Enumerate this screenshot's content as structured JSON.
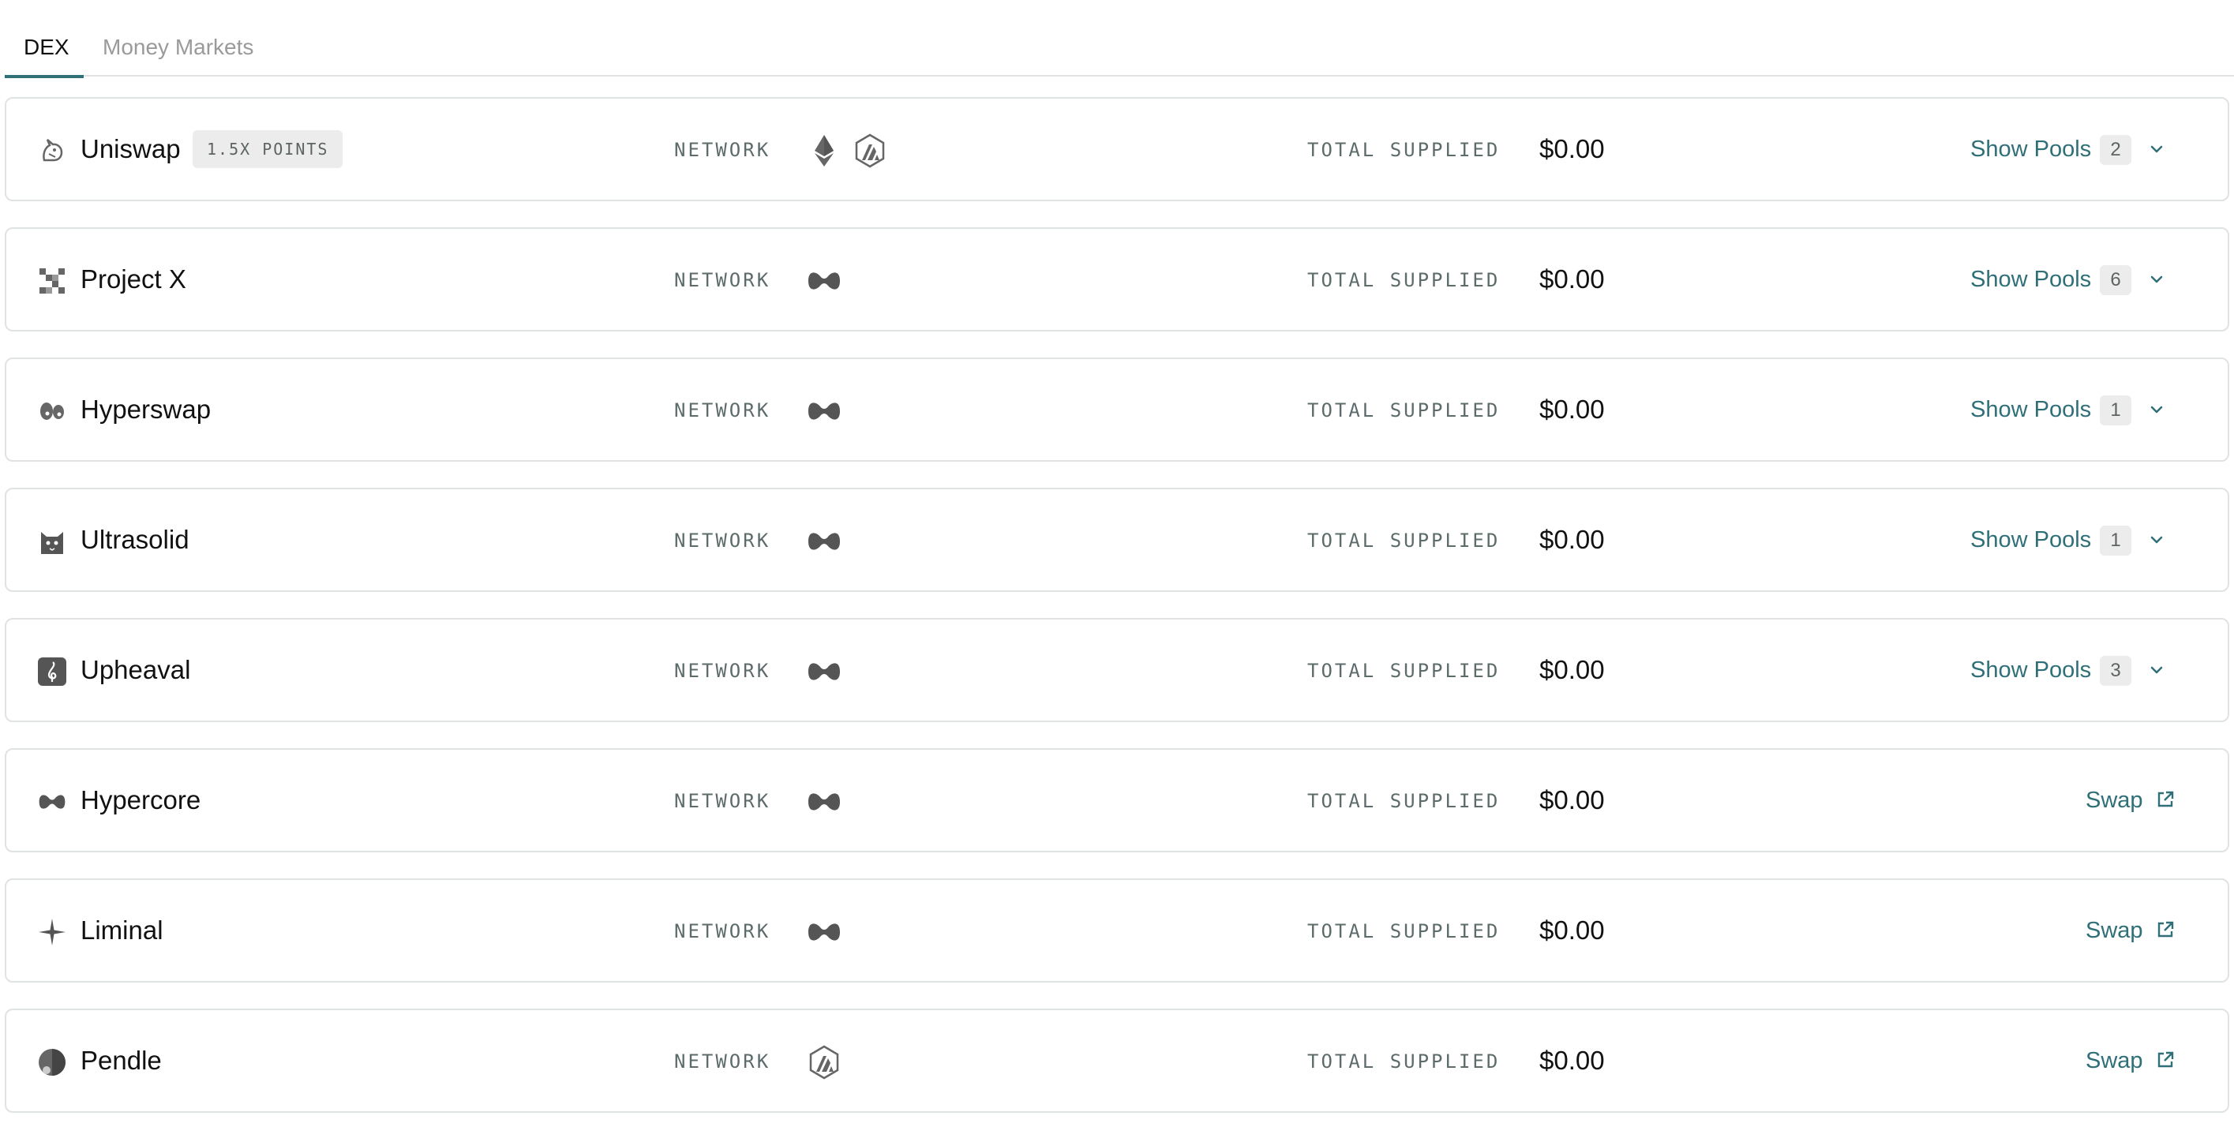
{
  "tabs": [
    {
      "label": "DEX",
      "active": true
    },
    {
      "label": "Money Markets",
      "active": false
    }
  ],
  "labels": {
    "network": "NETWORK",
    "total_supplied": "TOTAL SUPPLIED",
    "show_pools": "Show Pools",
    "swap": "Swap"
  },
  "colors": {
    "accent": "#2f6f78",
    "border": "#dfe3e3",
    "muted_label": "#5d6b6b",
    "badge_bg": "#ececec"
  },
  "rows": [
    {
      "name": "Uniswap",
      "icon": "unicorn-icon",
      "badge": "1.5X POINTS",
      "networks": [
        "ethereum-icon",
        "arbitrum-icon"
      ],
      "total_supplied": "$0.00",
      "action": "show_pools",
      "pool_count": "2"
    },
    {
      "name": "Project X",
      "icon": "pixel-x-icon",
      "networks": [
        "hyperliquid-icon"
      ],
      "total_supplied": "$0.00",
      "action": "show_pools",
      "pool_count": "6"
    },
    {
      "name": "Hyperswap",
      "icon": "eyes-icon",
      "networks": [
        "hyperliquid-icon"
      ],
      "total_supplied": "$0.00",
      "action": "show_pools",
      "pool_count": "1"
    },
    {
      "name": "Ultrasolid",
      "icon": "cat-icon",
      "networks": [
        "hyperliquid-icon"
      ],
      "total_supplied": "$0.00",
      "action": "show_pools",
      "pool_count": "1"
    },
    {
      "name": "Upheaval",
      "icon": "clef-icon",
      "networks": [
        "hyperliquid-icon"
      ],
      "total_supplied": "$0.00",
      "action": "show_pools",
      "pool_count": "3"
    },
    {
      "name": "Hypercore",
      "icon": "hyperliquid-icon",
      "networks": [
        "hyperliquid-icon"
      ],
      "total_supplied": "$0.00",
      "action": "swap"
    },
    {
      "name": "Liminal",
      "icon": "star-icon",
      "networks": [
        "hyperliquid-icon"
      ],
      "total_supplied": "$0.00",
      "action": "swap"
    },
    {
      "name": "Pendle",
      "icon": "pendle-icon",
      "networks": [
        "arbitrum-icon"
      ],
      "total_supplied": "$0.00",
      "action": "swap"
    }
  ]
}
